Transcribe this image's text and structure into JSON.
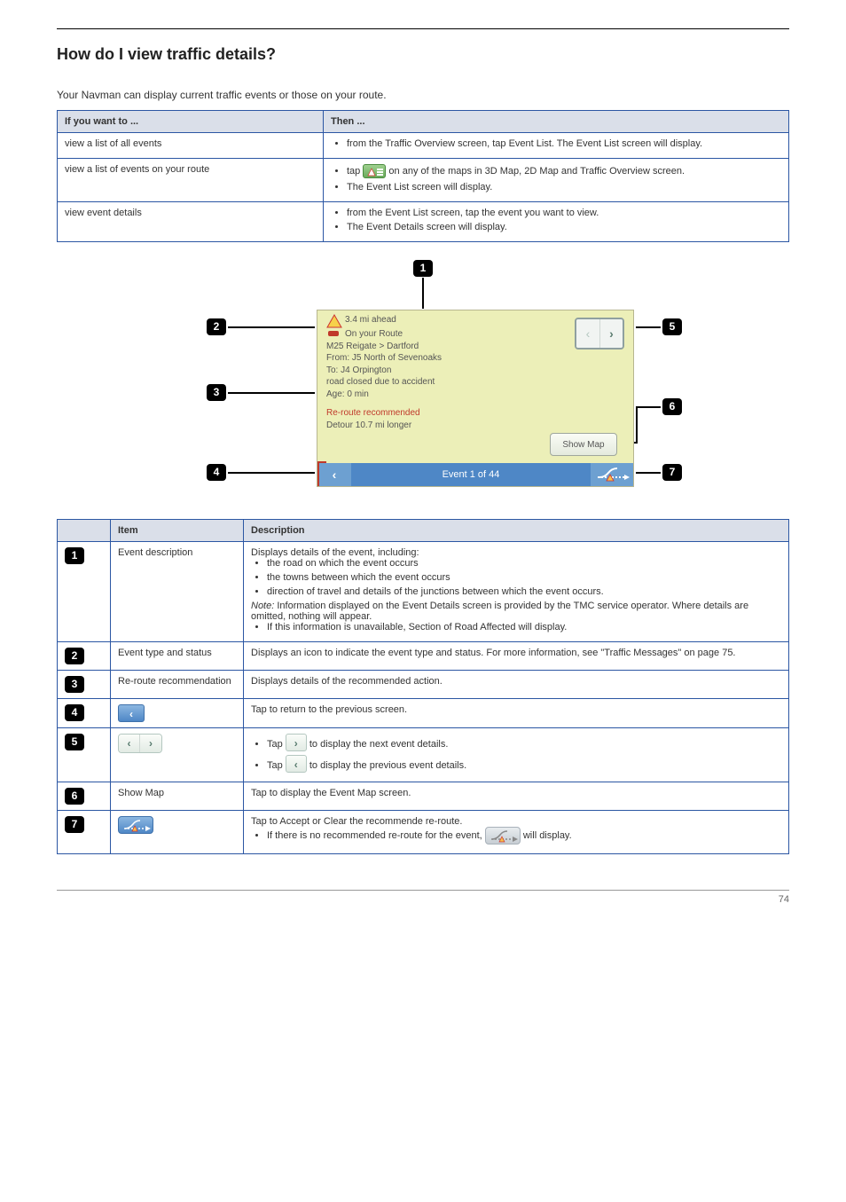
{
  "heading": "How do I view traffic details?",
  "intro": "Your Navman can display current traffic events or those on your route.",
  "open_table": {
    "head_if": "If you want to ...",
    "head_then": "Then ...",
    "rows": [
      {
        "if_text": "view a list of all events",
        "then_items": [
          "from the Traffic Overview screen, tap Event List. The Event List screen will display."
        ]
      },
      {
        "if_text": "view a list of events on your route",
        "then_items": [
          {
            "pre": "tap ",
            "icon": "event-list-icon",
            "post": " on any of the maps in 3D Map, 2D Map and Traffic Overview screen."
          },
          {
            "pre": "The Event List screen will display.",
            "post": ""
          }
        ]
      },
      {
        "if_text": "view event details",
        "then_items": [
          "from the Event List screen, tap the event you want to view.",
          "The Event Details screen will display."
        ]
      }
    ]
  },
  "diagram": {
    "badges": {
      "1": "1",
      "2": "2",
      "3": "3",
      "4": "4",
      "5": "5",
      "6": "6",
      "7": "7"
    }
  },
  "panel": {
    "ahead": "3.4 mi ahead",
    "on_route": "On your Route",
    "road": "M25 Reigate > Dartford",
    "from": "From: J5 North of Sevenoaks",
    "to": "To: J4 Orpington",
    "reason": "road closed due to accident",
    "age": "Age: 0 min",
    "reroute": "Re-route recommended",
    "detour": "Detour 10.7 mi longer",
    "show_map": "Show Map",
    "pager": "Event 1 of 44"
  },
  "callouts": {
    "head_item": "Item",
    "head_desc": "Description",
    "rows": [
      {
        "num": "1",
        "item": "Event description",
        "desc_intro": "Displays details of the event, including:",
        "desc_bullets": [
          "the road on which the event occurs",
          "the towns between which the event occurs",
          "direction of travel and details of the junctions between which the event occurs."
        ],
        "desc_note_label": "Note:",
        "desc_note": " Information displayed on the Event Details screen is provided by the TMC service operator. Where details are omitted, nothing will appear.",
        "desc_bullets2": [
          "If this information is unavailable, Section of Road Affected will display."
        ]
      },
      {
        "num": "2",
        "item": "Event type and status",
        "desc": "Displays an icon to indicate the event type and status. For more information, see \"Traffic Messages\" on page 75."
      },
      {
        "num": "3",
        "item": "Re-route recommendation",
        "desc": "Displays details of the recommended action."
      },
      {
        "num": "4",
        "item_icon": "back-blue",
        "desc": "Tap to return to the previous screen."
      },
      {
        "num": "5",
        "item_icon": "prev-next-pair",
        "desc_bullets": [
          {
            "pre": "Tap ",
            "icon": "next",
            "post": " to display the next event details."
          },
          {
            "pre": "Tap ",
            "icon": "prev",
            "post": " to display the previous event details."
          }
        ]
      },
      {
        "num": "6",
        "item": "Show Map",
        "desc": "Tap to display the Event Map screen."
      },
      {
        "num": "7",
        "item_icon": "divert-blue",
        "desc_intro": "Tap to Accept or Clear the recommende re-route.",
        "desc_bullets": [
          {
            "pre": "If there is no recommended re-route for the event, ",
            "icon": "divert-grey",
            "post": " will display."
          }
        ]
      }
    ]
  },
  "footer_page": "74"
}
